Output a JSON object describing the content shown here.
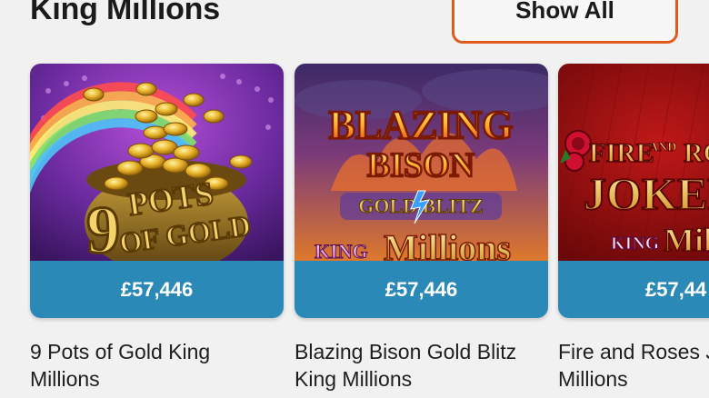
{
  "section": {
    "title": "King Millions",
    "show_all_label": "Show All"
  },
  "games": [
    {
      "name": "9 Pots of Gold King Millions",
      "jackpot": "£57,446",
      "art_text": [
        "9",
        "POTS",
        "OF GOLD"
      ]
    },
    {
      "name": "Blazing Bison Gold Blitz King Millions",
      "jackpot": "£57,446",
      "art_text": [
        "BLAZING",
        "BISON",
        "GOLD BLITZ",
        "KING",
        "Millions"
      ]
    },
    {
      "name": "Fire and Roses Joker King Millions",
      "display_name": "Fire and Roses J King Millions",
      "jackpot": "£57,44",
      "art_text": [
        "FIRE",
        "AND",
        "ROSES",
        "JOKER",
        "KING",
        "Mill"
      ]
    }
  ],
  "colors": {
    "accent_border": "#e05a1e",
    "jackpot_band": "#2b89b8",
    "background": "#f1f1f1"
  }
}
